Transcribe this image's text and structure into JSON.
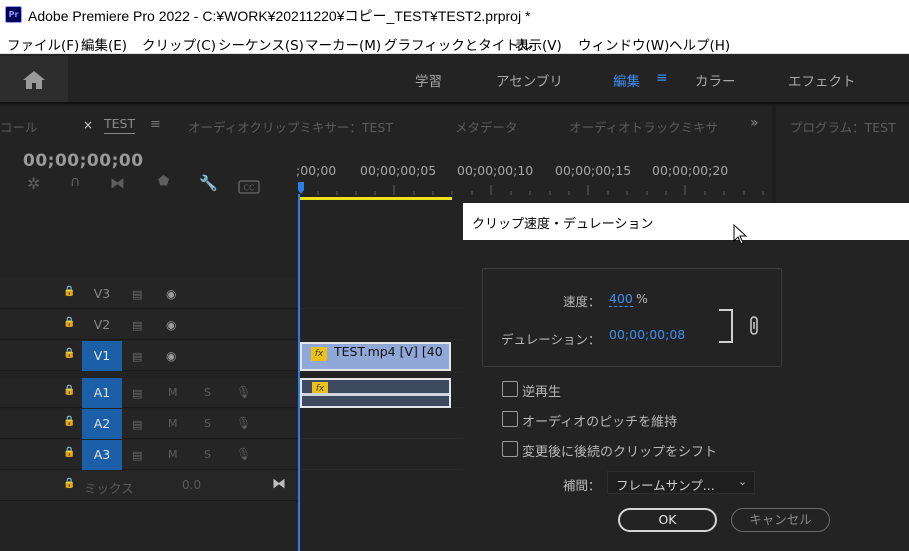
{
  "window": {
    "app_icon": "Pr",
    "title": "Adobe Premiere Pro 2022 - C:¥WORK¥20211220¥コピー_TEST¥TEST2.prproj *"
  },
  "menubar": [
    "ファイル(F)",
    "編集(E)",
    "クリップ(C)",
    "シーケンス(S)",
    "マーカー(M)",
    "グラフィックとタイトル",
    "表示(V)",
    "ウィンドウ(W)",
    "ヘルプ(H)"
  ],
  "workspaces": {
    "tabs": [
      "学習",
      "アセンブリ",
      "編集",
      "カラー",
      "エフェクト"
    ],
    "active": "編集"
  },
  "panel_tabs": {
    "left_cut": "コール",
    "sequence": "TEST",
    "audio_clip_mixer": "オーディオクリップミキサー：TEST",
    "metadata": "メタデータ",
    "audio_track_mixer": "オーディオトラックミキサ",
    "overflow": "»",
    "program": "プログラム：TEST"
  },
  "timeline": {
    "timecode": "00;00;00;00",
    "ruler": [
      ";00;00",
      "00;00;00;05",
      "00;00;00;10",
      "00;00;00;15",
      "00;00;00;20"
    ],
    "video_tracks": [
      "V3",
      "V2",
      "V1"
    ],
    "audio_tracks": [
      "A1",
      "A2",
      "A3"
    ],
    "selected_tracks": [
      "V1",
      "A1",
      "A2",
      "A3"
    ],
    "mute": "M",
    "solo": "S",
    "mix_label": "ミックス",
    "mix_value": "0.0",
    "video_clip_label": "TEST.mp4 [V] [40",
    "fx_badge": "fx"
  },
  "dialog": {
    "title": "クリップ速度・デュレーション",
    "speed_label": "速度：",
    "speed_value": "400",
    "speed_unit": "%",
    "duration_label": "デュレーション：",
    "duration_value": "00;00;00;08",
    "options": [
      {
        "label": "逆再生",
        "checked": false
      },
      {
        "label": "オーディオのピッチを維持",
        "checked": false
      },
      {
        "label": "変更後に後続のクリップをシフト",
        "checked": false
      }
    ],
    "interp_label": "補間：",
    "interp_value": "フレームサンプ...",
    "ok_label": "OK",
    "cancel_label": "キャンセル"
  },
  "colors": {
    "accent": "#3d8ef0",
    "track_selected": "#1b5fa8",
    "video_clip": "#8fa8d8",
    "audio_clip": "#3e4a60",
    "fx": "#e8c21a",
    "work_area": "#e8e31a"
  }
}
